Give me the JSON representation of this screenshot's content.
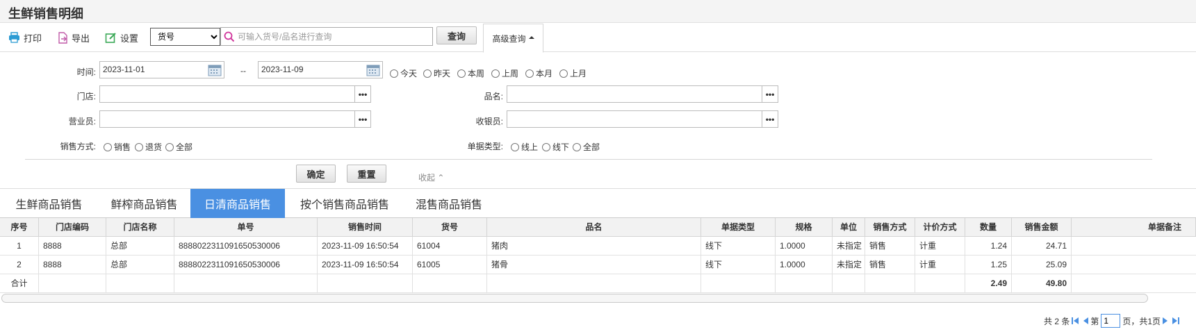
{
  "page_title": "生鲜销售明细",
  "toolbar": {
    "print": "打印",
    "export": "导出",
    "settings": "设置",
    "field_select": "货号",
    "field_options": [
      "货号"
    ],
    "search_placeholder": "可输入货号/品名进行查询",
    "query": "查询",
    "advanced": "高级查询"
  },
  "filters": {
    "time_label": "时间:",
    "date_from": "2023-11-01",
    "date_sep": "--",
    "date_to": "2023-11-09",
    "quick": [
      "今天",
      "昨天",
      "本周",
      "上周",
      "本月",
      "上月"
    ],
    "store_label": "门店:",
    "item_label": "品名:",
    "salesperson_label": "营业员:",
    "cashier_label": "收银员:",
    "sale_mode_label": "销售方式:",
    "sale_modes": [
      "销售",
      "退货",
      "全部"
    ],
    "doc_type_label": "单据类型:",
    "doc_types": [
      "线上",
      "线下",
      "全部"
    ],
    "confirm": "确定",
    "reset": "重置",
    "collapse": "收起"
  },
  "tabs": [
    "生鲜商品销售",
    "鲜榨商品销售",
    "日清商品销售",
    "按个销售商品销售",
    "混售商品销售"
  ],
  "active_tab": 2,
  "table": {
    "columns": [
      "序号",
      "门店编码",
      "门店名称",
      "单号",
      "销售时间",
      "货号",
      "品名",
      "单据类型",
      "规格",
      "单位",
      "销售方式",
      "计价方式",
      "数量",
      "销售金额",
      "单据备注"
    ],
    "rows": [
      [
        "1",
        "8888",
        "总部",
        "888802231109165053000​6",
        "2023-11-09 16:50:54",
        "61004",
        "猪肉",
        "线下",
        "1.0000",
        "未指定",
        "销售",
        "计重",
        "1.24",
        "24.71",
        ""
      ],
      [
        "2",
        "8888",
        "总部",
        "8888022311091650530006",
        "2023-11-09 16:50:54",
        "61005",
        "猪骨",
        "线下",
        "1.0000",
        "未指定",
        "销售",
        "计重",
        "1.25",
        "25.09",
        ""
      ]
    ],
    "total_label": "合计",
    "total_qty": "2.49",
    "total_amount": "49.80"
  },
  "pager": {
    "total": "共 2 条",
    "page_prefix": "第",
    "page": "1",
    "page_suffix": "页，共1页"
  }
}
